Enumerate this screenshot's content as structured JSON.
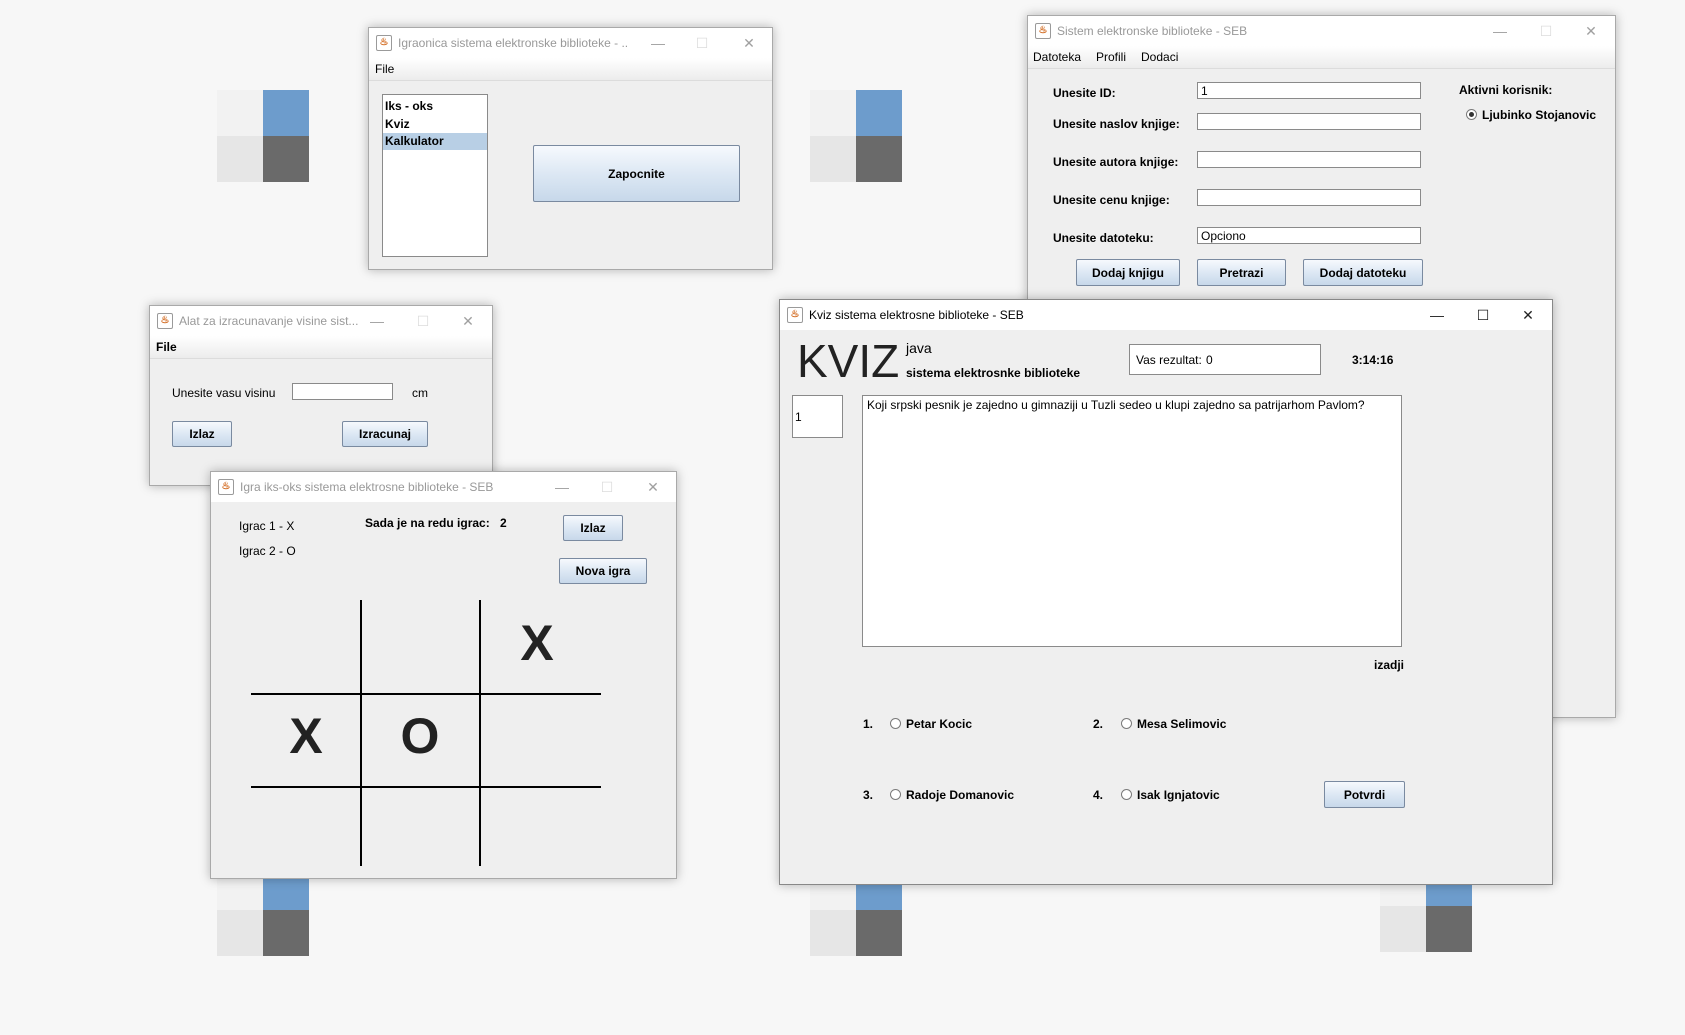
{
  "game_room": {
    "title": "Igraonica sistema elektronske biblioteke - ...",
    "menu_file": "File",
    "list_items": [
      "Iks - oks",
      "Kviz",
      "Kalkulator"
    ],
    "selected_index": 2,
    "start_button": "Zapocnite"
  },
  "library": {
    "title": "Sistem elektronske biblioteke - SEB",
    "menus": [
      "Datoteka",
      "Profili",
      "Dodaci"
    ],
    "id_label": "Unesite ID:",
    "id_value": "1",
    "title_label": "Unesite naslov knjige:",
    "title_value": "",
    "author_label": "Unesite autora knjige:",
    "author_value": "",
    "price_label": "Unesite cenu knjige:",
    "price_value": "",
    "file_label": "Unesite datoteku:",
    "file_value": "Opciono",
    "add_book_button": "Dodaj knjigu",
    "search_button": "Pretrazi",
    "add_file_button": "Dodaj datoteku",
    "active_user_label": "Aktivni korisnik:",
    "active_user": "Ljubinko Stojanovic"
  },
  "height_tool": {
    "title": "Alat za izracunavanje visine sist...",
    "menu_file": "File",
    "prompt": "Unesite vasu visinu",
    "height_value": "",
    "unit": "cm",
    "exit_button": "Izlaz",
    "calc_button": "Izracunaj"
  },
  "tictactoe": {
    "title": "Igra iks-oks sistema elektrosne biblioteke - SEB",
    "player1": "Igrac 1 - X",
    "player2": "Igrac 2 - O",
    "turn_label": "Sada je na redu igrac:",
    "turn_value": "2",
    "exit_button": "Izlaz",
    "new_game_button": "Nova igra",
    "board": [
      "",
      "",
      "X",
      "X",
      "O",
      "",
      "",
      "",
      ""
    ]
  },
  "quiz": {
    "title": "Kviz sistema elektrosne biblioteke - SEB",
    "logo": "KVIZ",
    "logo_sub1": "java",
    "logo_sub2": "sistema elektrosnke biblioteke",
    "score_label": "Vas rezultat:",
    "score_value": "0",
    "timer": "3:14:16",
    "question_number": "1",
    "question": "Koji srpski pesnik je zajedno u gimnaziji u Tuzli sedeo u klupi zajedno sa patrijarhom Pavlom?",
    "exit_label": "izadji",
    "answers": [
      {
        "num": "1.",
        "text": "Petar Kocic"
      },
      {
        "num": "2.",
        "text": "Mesa Selimovic"
      },
      {
        "num": "3.",
        "text": "Radoje Domanovic"
      },
      {
        "num": "4.",
        "text": "Isak Ignjatovic"
      }
    ],
    "confirm_button": "Potvrdi"
  }
}
